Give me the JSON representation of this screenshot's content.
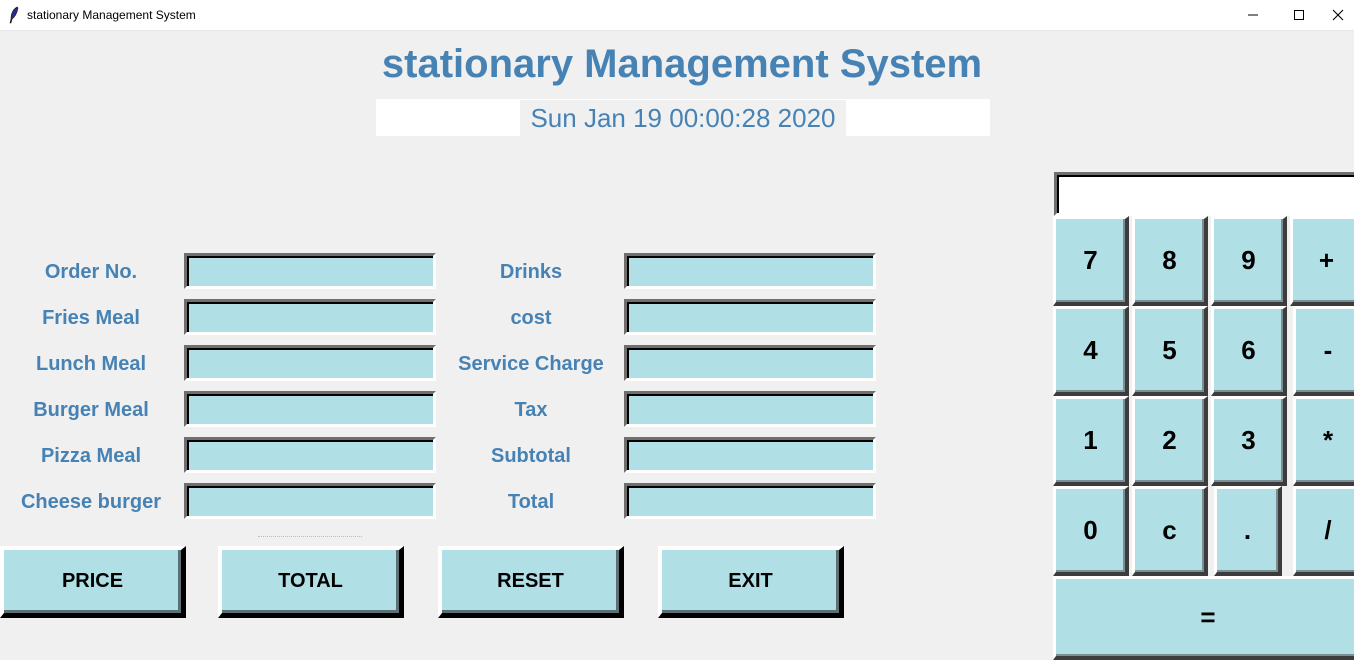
{
  "window": {
    "title": "stationary Management System",
    "controls": [
      "minimize",
      "maximize",
      "close"
    ]
  },
  "header": {
    "title": "stationary Management System",
    "datetime": "Sun Jan 19 00:00:28 2020",
    "color": "#4682b4"
  },
  "form": {
    "left": [
      {
        "label": "Order No.",
        "value": ""
      },
      {
        "label": "Fries Meal",
        "value": ""
      },
      {
        "label": "Lunch Meal",
        "value": ""
      },
      {
        "label": "Burger Meal",
        "value": ""
      },
      {
        "label": "Pizza Meal",
        "value": ""
      },
      {
        "label": "Cheese burger",
        "value": ""
      }
    ],
    "right": [
      {
        "label": "Drinks",
        "value": ""
      },
      {
        "label": "cost",
        "value": ""
      },
      {
        "label": "Service Charge",
        "value": ""
      },
      {
        "label": "Tax",
        "value": ""
      },
      {
        "label": "Subtotal",
        "value": ""
      },
      {
        "label": "Total",
        "value": ""
      }
    ],
    "field_color": "#b0e0e6"
  },
  "buttons": [
    "PRICE",
    "TOTAL",
    "RESET",
    "EXIT"
  ],
  "calculator": {
    "display_value": "",
    "keys": [
      [
        "7",
        "8",
        "9",
        "+"
      ],
      [
        "4",
        "5",
        "6",
        "-"
      ],
      [
        "1",
        "2",
        "3",
        "*"
      ],
      [
        "0",
        "c",
        ".",
        "/"
      ]
    ],
    "equals": "="
  }
}
